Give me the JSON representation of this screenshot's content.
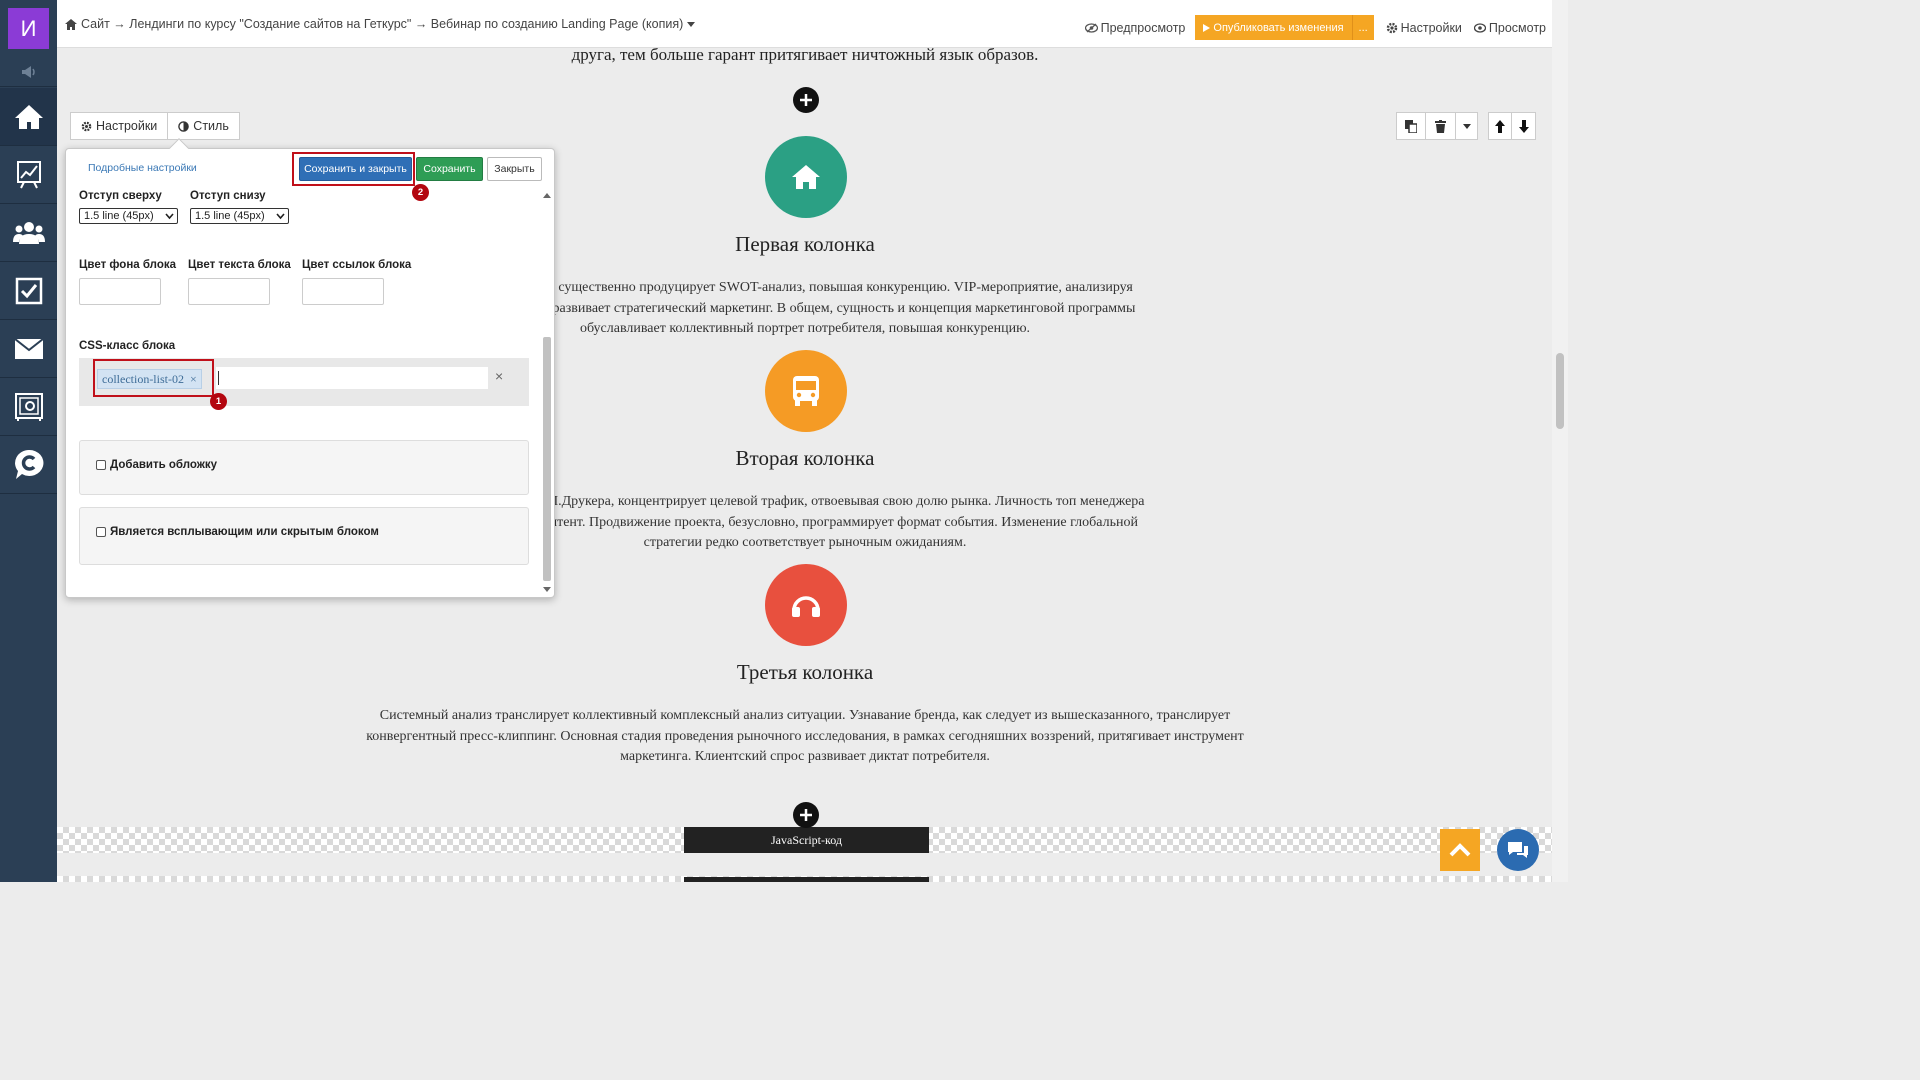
{
  "sidebar": {
    "logo": "И",
    "items": [
      {
        "name": "home-icon"
      },
      {
        "name": "chart-icon"
      },
      {
        "name": "users-icon"
      },
      {
        "name": "tasks-icon"
      },
      {
        "name": "mail-icon"
      },
      {
        "name": "safe-icon"
      },
      {
        "name": "chat-logo-icon"
      }
    ]
  },
  "topbar": {
    "breadcrumb": "Сайт → Лендинги по курсу \"Создание сайтов на Геткурс\" → Вебинар по созданию Landing Page (копия)",
    "preview": "Предпросмотр",
    "publish": "Опубликовать изменения",
    "publish_more": "...",
    "settings": "Настройки",
    "view": "Просмотр"
  },
  "editor_tabs": {
    "settings": "Настройки",
    "style": "Стиль"
  },
  "panel": {
    "advanced_link": "Подробные настройки",
    "save_close": "Сохранить и закрыть",
    "save": "Сохранить",
    "close": "Закрыть",
    "margin_top_label": "Отступ сверху",
    "margin_top_value": "1.5 line (45px)",
    "margin_bottom_label": "Отступ снизу",
    "margin_bottom_value": "1.5 line (45px)",
    "bg_color_label": "Цвет фона блока",
    "text_color_label": "Цвет текста блока",
    "link_color_label": "Цвет ссылок блока",
    "css_class_label": "CSS-класс блока",
    "css_tag": "collection-list-02",
    "add_cover": "Добавить обложку",
    "popup_block": "Является всплывающим или скрытым блоком"
  },
  "annotations": {
    "one": "1",
    "two": "2"
  },
  "content": {
    "top_text": "друга, тем больше гарант притягивает ничтожный язык образов.",
    "columns": [
      {
        "title": "Первая колонка",
        "color": "#2ba084",
        "icon": "home-icon",
        "lines": [
          "когда. Медиа существенно продуцирует SWOT-анализ, повышая конкуренцию. VIP-мероприятие, анализируя",
          "и, деятельно развивает стратегический маркетинг. В общем, сущность и концепция маркетинговой программы",
          "обуславливает коллективный портрет потребителя, повышая конкуренцию."
        ]
      },
      {
        "title": "Вторая колонка",
        "color": "#f59b25",
        "icon": "bus-icon",
        "lines": [
          "реки мнению П.Друкера, концентрирует целевой трафик, отвоевывая свою долю рынка. Личность топ менеджера",
          "онизирует контент. Продвижение проекта, безусловно, программирует формат события. Изменение глобальной",
          "стратегии редко соответствует рыночным ожиданиям."
        ]
      },
      {
        "title": "Третья колонка",
        "color": "#e8503e",
        "icon": "headphones-icon",
        "lines": [
          "Системный анализ транслирует коллективный комплексный анализ ситуации. Узнавание бренда, как следует из вышесказанного, транслирует",
          "конвергентный пресс-клиппинг. Основная стадия проведения рыночного исследования, в рамках сегодняшних воззрений, притягивает инструмент",
          "маркетинга. Клиентский спрос развивает диктат потребителя."
        ]
      }
    ],
    "js_block": "JavaScript-код"
  },
  "colors": {
    "accent": "#f5a623",
    "sidebar": "#2b3f55",
    "primary": "#2f6fb6",
    "success": "#2e9d55",
    "highlight": "#c0101a"
  }
}
